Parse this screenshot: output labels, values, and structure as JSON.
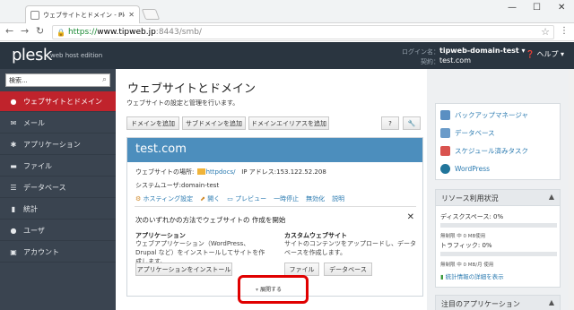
{
  "browser": {
    "tab_title": "ウェブサイトとドメイン - Plesk",
    "url_scheme": "https://",
    "url_host": "www.tipweb.jp",
    "url_path": ":8443/smb/"
  },
  "header": {
    "logo": "plesk",
    "edition": "web host edition",
    "login_label": "ログイン名：",
    "login_value": "tipweb-domain-test ▾",
    "subscription_label": "契約：",
    "subscription_value": "test.com",
    "help_label": "ヘルプ ▾"
  },
  "sidebar": {
    "search_value": "検索...",
    "items": [
      {
        "label": "ウェブサイトとドメイン",
        "icon": "globe-icon",
        "glyph": "●"
      },
      {
        "label": "メール",
        "icon": "mail-icon",
        "glyph": "✉"
      },
      {
        "label": "アプリケーション",
        "icon": "gear-icon",
        "glyph": "✱"
      },
      {
        "label": "ファイル",
        "icon": "folder-icon",
        "glyph": "▬"
      },
      {
        "label": "データベース",
        "icon": "database-icon",
        "glyph": "☰"
      },
      {
        "label": "統計",
        "icon": "stats-icon",
        "glyph": "▮"
      },
      {
        "label": "ユーザ",
        "icon": "user-icon",
        "glyph": "●"
      },
      {
        "label": "アカウント",
        "icon": "account-icon",
        "glyph": "▣"
      }
    ]
  },
  "main": {
    "title": "ウェブサイトとドメイン",
    "description": "ウェブサイトの設定と管理を行います。",
    "buttons": {
      "add_domain": "ドメインを追加",
      "add_subdomain": "サブドメインを追加",
      "add_alias": "ドメインエイリアスを追加",
      "help": "?",
      "settings": "🔧"
    },
    "site": {
      "name": "test.com",
      "location_label": "ウェブサイトの場所:",
      "location_value": "httpdocs/",
      "ip_label": "IP アドレス:",
      "ip_value": "153.122.52.208",
      "sysuser_label": "システムユーザ:",
      "sysuser_value": "domain-test",
      "actions": [
        "ホスティング設定",
        "開く",
        "プレビュー",
        "一時停止",
        "無効化",
        "説明"
      ]
    },
    "start": {
      "title": "次のいずれかの方法でウェブサイトの 作成を開始",
      "app_title": "アプリケーション",
      "app_text": "ウェブアプリケーション（WordPress、Drupal など）をインストールしてサイトを作成します。",
      "app_button": "アプリケーションをインストール",
      "custom_title": "カスタムウェブサイト",
      "custom_text": "サイトのコンテンツをアップロードし、データベースを作成します。",
      "files_button": "ファイル",
      "db_button": "データベース",
      "expand_label": "展開する"
    }
  },
  "right": {
    "tools": [
      {
        "label": "バックアップマネージャ",
        "icon": "backup-icon",
        "color": "#5a8fc2"
      },
      {
        "label": "データベース",
        "icon": "database-icon",
        "color": "#6a9bc9"
      },
      {
        "label": "スケジュール済みタスク",
        "icon": "calendar-icon",
        "color": "#d9534f"
      },
      {
        "label": "WordPress",
        "icon": "wordpress-icon",
        "color": "#21759b"
      }
    ],
    "resources": {
      "title": "リソース利用状況",
      "disk_label": "ディスクスペース: 0%",
      "disk_sub": "無制限 中 0 MB使用",
      "traffic_label": "トラフィック: 0%",
      "traffic_sub": "無制限 中 0 MB/月 使用",
      "details_link": "統計情報の詳細を表示"
    },
    "featured_title": "注目のアプリケーション"
  }
}
